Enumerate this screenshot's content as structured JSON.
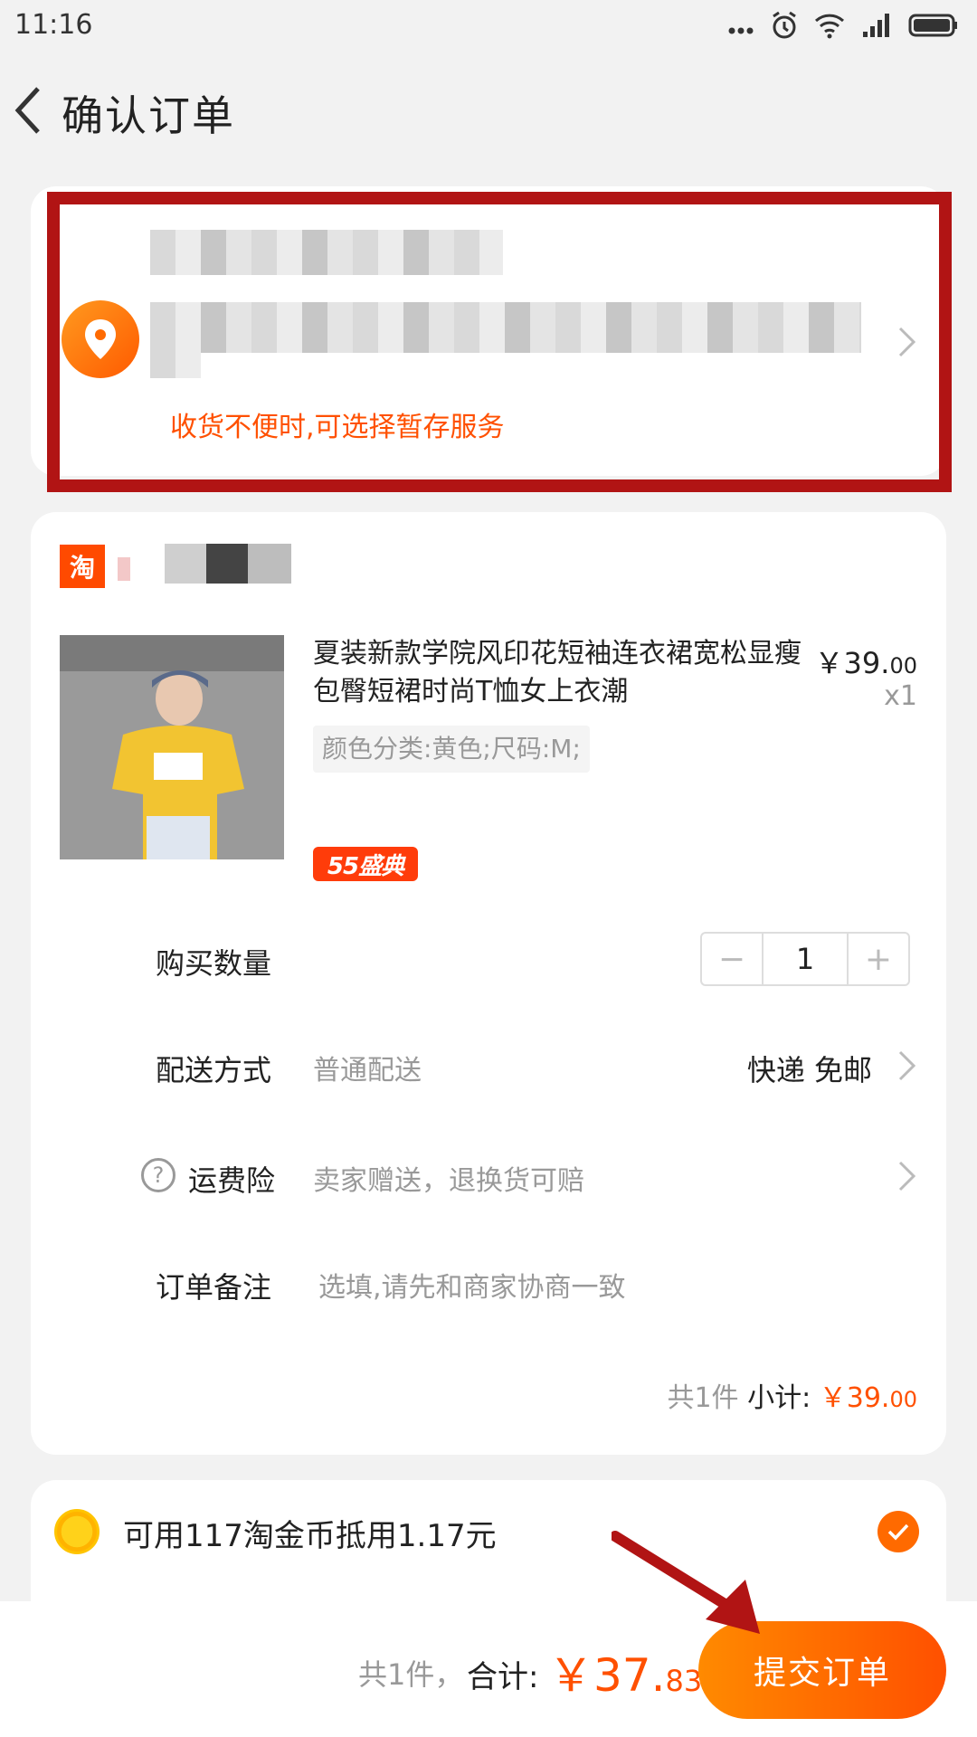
{
  "status_bar": {
    "time": "11:16"
  },
  "nav": {
    "title": "确认订单"
  },
  "address": {
    "tip": "收货不便时,可选择暂存服务"
  },
  "shop": {
    "icon_text": "淘"
  },
  "product": {
    "title": "夏装新款学院风印花短袖连衣裙宽松显瘦包臀短裙时尚T恤女上衣潮",
    "price_main": "￥39.",
    "price_cents": "00",
    "quantity": "x1",
    "sku": "颜色分类:黄色;尺码:M;",
    "promo_badge": "55盛典"
  },
  "rows": {
    "quantity_label": "购买数量",
    "quantity_value": "1",
    "shipping_label": "配送方式",
    "shipping_method": "普通配送",
    "shipping_value": "快递 免邮",
    "insurance_label": "运费险",
    "insurance_value": "卖家赠送，退换货可赔",
    "note_label": "订单备注",
    "note_placeholder": "选填,请先和商家协商一致"
  },
  "subtotal": {
    "count": "共1件",
    "label": " 小计: ",
    "amount_main": "￥39.",
    "amount_cents": "00"
  },
  "coins": {
    "text": "可用117淘金币抵用1.17元"
  },
  "bottom": {
    "count": "共1件，",
    "label": "合计:",
    "amount_main": "￥37.",
    "amount_cents": "83",
    "submit_label": "提交订单"
  },
  "colors": {
    "accent": "#ff5000",
    "highlight": "#b11414"
  },
  "icons": [
    "back-icon",
    "location-icon",
    "chevron-right-icon",
    "help-icon",
    "coin-icon",
    "check-icon"
  ]
}
